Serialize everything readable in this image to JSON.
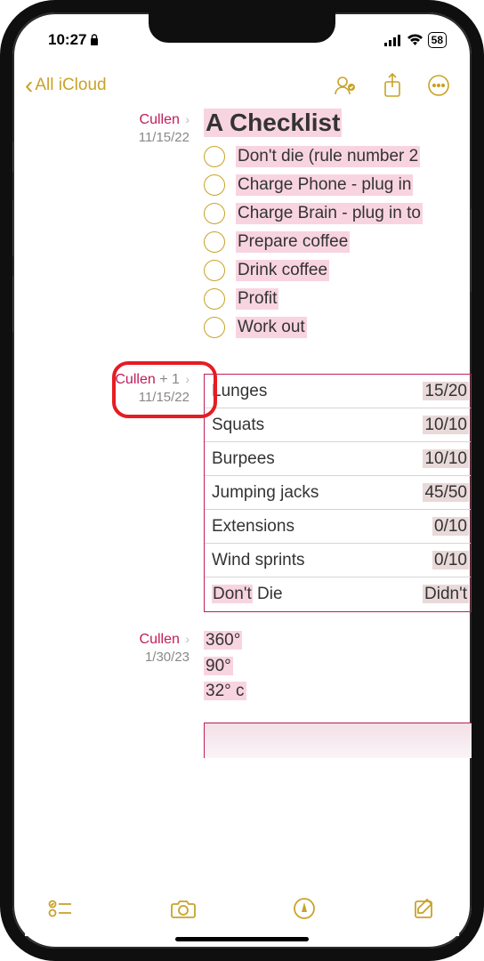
{
  "status": {
    "time": "10:27",
    "battery": "58"
  },
  "nav": {
    "back_label": "All iCloud"
  },
  "entries": [
    {
      "author": "Cullen",
      "date": "11/15/22",
      "heading": "A Checklist",
      "checklist": [
        "Don't die (rule number 2",
        "Charge Phone - plug in ",
        "Charge Brain - plug in to",
        "Prepare coffee",
        "Drink coffee",
        "Profit",
        "Work out"
      ]
    },
    {
      "author": "Cullen",
      "plus": "+ 1",
      "date": "11/15/22",
      "table": [
        {
          "name": "Lunges",
          "value": "15/20"
        },
        {
          "name": "Squats",
          "value": "10/10"
        },
        {
          "name": "Burpees",
          "value": "10/10"
        },
        {
          "name": "Jumping jacks",
          "value": "45/50"
        },
        {
          "name": "Extensions",
          "value": "0/10"
        },
        {
          "name": "Wind sprints",
          "value": "0/10"
        },
        {
          "name_hl": "Don't",
          "name_rest": " Die",
          "value": "Didn't"
        }
      ]
    },
    {
      "author": "Cullen",
      "date": "1/30/23",
      "temps": [
        "360°",
        "90°",
        "32° c"
      ]
    }
  ]
}
